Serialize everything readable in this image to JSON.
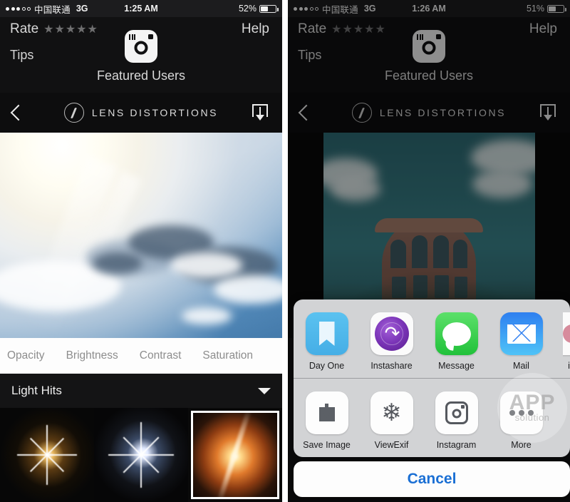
{
  "left_phone": {
    "status_bar": {
      "signal_icon": "signal-dots-3-of-5",
      "carrier": "中国联通",
      "network": "3G",
      "time": "1:25 AM",
      "battery_percent": "52%",
      "battery_level": 52
    },
    "promo_header": {
      "rate_label": "Rate",
      "rate_stars": "★★★★★",
      "tips_label": "Tips",
      "help_label": "Help",
      "featured_icon": "instagram-icon",
      "featured_label": "Featured Users"
    },
    "nav_bar": {
      "back_icon": "chevron-left-icon",
      "brand_icon": "lens-distortions-logo-icon",
      "brand_title": "LENS DISTORTIONS",
      "download_icon": "download-icon"
    },
    "photo": {
      "alt": "sun-rays-through-clouds-photo"
    },
    "adjust_toolbar": [
      "Opacity",
      "Brightness",
      "Contrast",
      "Saturation"
    ],
    "layer_row": {
      "label": "Light Hits",
      "chevron_icon": "chevron-down-icon"
    },
    "thumbnails": [
      {
        "name": "star-flare-warm-thumbnail",
        "selected": false
      },
      {
        "name": "star-flare-cool-thumbnail",
        "selected": false
      },
      {
        "name": "orange-lens-flare-thumbnail",
        "selected": true
      }
    ]
  },
  "right_phone": {
    "status_bar": {
      "signal_icon": "signal-dots-3-of-5",
      "carrier": "中国联通",
      "network": "3G",
      "time": "1:26 AM",
      "battery_percent": "51%",
      "battery_level": 51
    },
    "promo_header": {
      "rate_label": "Rate",
      "rate_stars": "★★★★★",
      "tips_label": "Tips",
      "help_label": "Help",
      "featured_icon": "instagram-icon",
      "featured_label": "Featured Users"
    },
    "nav_bar": {
      "back_icon": "chevron-left-icon",
      "brand_icon": "lens-distortions-logo-icon",
      "brand_title": "LENS DISTORTIONS",
      "download_icon": "download-icon"
    },
    "photo": {
      "alt": "round-brick-building-against-teal-sky-photo"
    },
    "share_sheet": {
      "row1": [
        {
          "label": "Day One",
          "icon": "day-one-icon"
        },
        {
          "label": "Instashare",
          "icon": "instashare-icon"
        },
        {
          "label": "Message",
          "icon": "messages-icon"
        },
        {
          "label": "Mail",
          "icon": "mail-icon"
        },
        {
          "label": "iC",
          "icon": "icloud-icon"
        }
      ],
      "row2": [
        {
          "label": "Save Image",
          "icon": "save-image-icon"
        },
        {
          "label": "ViewExif",
          "icon": "viewexif-snowflake-icon"
        },
        {
          "label": "Instagram",
          "icon": "instagram-icon"
        },
        {
          "label": "More",
          "icon": "more-dots-icon"
        }
      ],
      "cancel_label": "Cancel",
      "cancel_color": "#1a6fd4"
    },
    "watermark": {
      "line1": "APP",
      "line2": "solution"
    }
  }
}
